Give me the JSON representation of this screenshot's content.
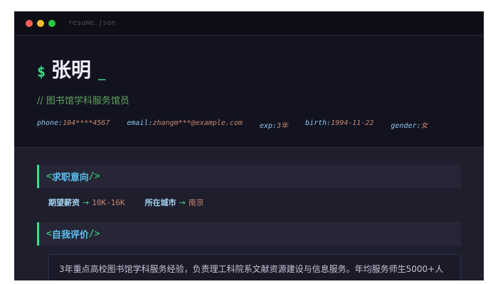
{
  "window": {
    "title": "resume.json",
    "dots": [
      "#ff5f57",
      "#febc2e",
      "#28c840"
    ]
  },
  "header": {
    "prompt": "$",
    "name": "张明",
    "cursor": "_",
    "role": "// 图书馆学科服务馆员",
    "meta": [
      {
        "k": "phone:",
        "v": "104****4567"
      },
      {
        "k": "email:",
        "v": "zhangm***@example.com"
      },
      {
        "k": "exp:",
        "v": "3年"
      },
      {
        "k": "birth:",
        "v": "1994-11-22"
      },
      {
        "k": "gender:",
        "v": "女"
      }
    ]
  },
  "sections": [
    {
      "open": "<",
      "title": "求职意向",
      "close": "/>",
      "items": [
        {
          "label": "期望薪资",
          "arrow": "→",
          "value": "10K-16K"
        },
        {
          "label": "所在城市",
          "arrow": "→",
          "value": "南京"
        }
      ]
    },
    {
      "open": "<",
      "title": "自我评价",
      "close": "/>",
      "text": "3年重点高校图书馆学科服务经验，负责理工科院系文献资源建设与信息服务。年均服务师生5000+人"
    }
  ]
}
